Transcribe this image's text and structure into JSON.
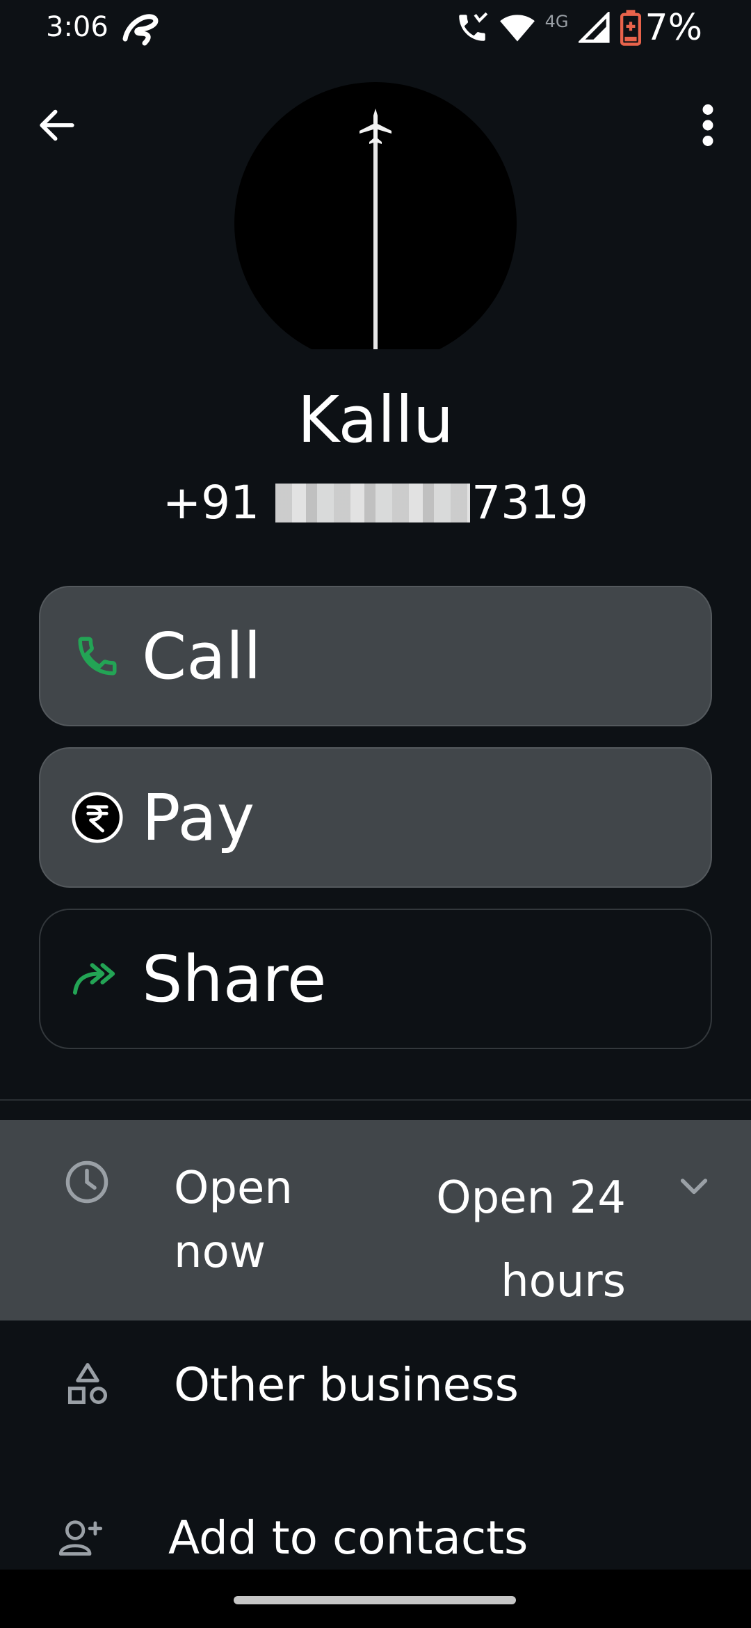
{
  "status_bar": {
    "time": "3:06",
    "network_label": "4G",
    "battery_percent": "7%",
    "icons": [
      "carrier-icon",
      "wifi-calling-icon",
      "wifi-icon",
      "signal-icon",
      "battery-low-icon"
    ]
  },
  "top_bar": {
    "back_icon": "arrow-left-icon",
    "more_icon": "more-vertical-icon"
  },
  "contact": {
    "name": "Kallu",
    "phone_prefix": "+91",
    "phone_suffix": "7319"
  },
  "actions": [
    {
      "label": "Call",
      "icon": "phone-icon",
      "icon_color": "#23a455"
    },
    {
      "label": "Pay",
      "icon": "rupee-icon"
    },
    {
      "label": "Share",
      "icon": "share-arrow-icon",
      "icon_color": "#23a455"
    }
  ],
  "hours": {
    "status_line1": "Open",
    "status_line2": "now",
    "detail_line1": "Open 24",
    "detail_line2": "hours",
    "icon": "clock-icon",
    "expand_icon": "chevron-down-icon"
  },
  "list_items": [
    {
      "label": "Other business",
      "icon": "shapes-icon"
    },
    {
      "label": "Add to contacts",
      "icon": "add-person-icon"
    }
  ],
  "colors": {
    "background": "#0d1115",
    "button_fill": "#41464a",
    "accent_green": "#23a455"
  }
}
